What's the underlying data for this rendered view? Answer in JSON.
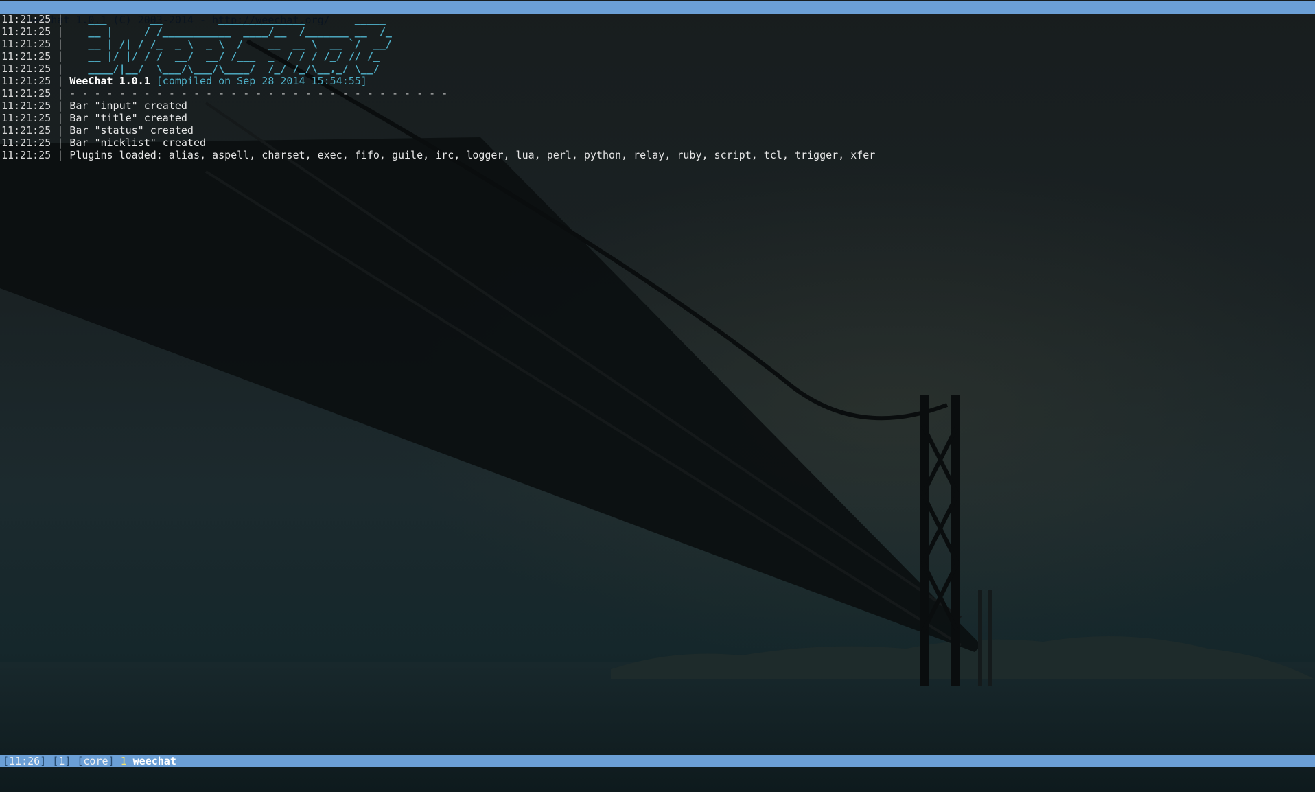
{
  "title_bar": {
    "text": "WeeChat 1.0.1 (C) 2003-2014 - http://weechat.org/"
  },
  "chat": {
    "separator": "|",
    "logo_lines": [
      {
        "time": "11:21:25",
        "text": "   ___       __         ______________        _____ "
      },
      {
        "time": "11:21:25",
        "text": "   __ |     / /___________  ____/__  /_______ __  /_"
      },
      {
        "time": "11:21:25",
        "text": "   __ | /| / /_  _ \\  _ \\  /    __  __ \\  __ `/  __/"
      },
      {
        "time": "11:21:25",
        "text": "   __ |/ |/ / /  __/  __/ /___  _  / / / /_/ // /_  "
      },
      {
        "time": "11:21:25",
        "text": "   ____/|__/  \\___/\\___/\\____/  /_/ /_/\\__,_/ \\__/  "
      }
    ],
    "version_line": {
      "time": "11:21:25",
      "name": "WeeChat 1.0.1",
      "compiled": "[compiled on Sep 28 2014 15:54:55]"
    },
    "dashes_line": {
      "time": "11:21:25",
      "text": "- - - - - - - - - - - - - - - - - - - - - - - - - - - - - - -"
    },
    "messages": [
      {
        "time": "11:21:25",
        "text": "Bar \"input\" created"
      },
      {
        "time": "11:21:25",
        "text": "Bar \"title\" created"
      },
      {
        "time": "11:21:25",
        "text": "Bar \"status\" created"
      },
      {
        "time": "11:21:25",
        "text": "Bar \"nicklist\" created"
      },
      {
        "time": "11:21:25",
        "text": "Plugins loaded: alias, aspell, charset, exec, fifo, guile, irc, logger, lua, perl, python, relay, ruby, script, tcl, trigger, xfer"
      }
    ]
  },
  "status_bar": {
    "time": "11:26",
    "buffer_count": "1",
    "plugin": "core",
    "buffer_number": "1",
    "buffer_name": "weechat",
    "open_bracket": "[",
    "close_bracket": "]"
  },
  "input": {
    "value": ""
  },
  "colors": {
    "bar_background": "#6b9fd6",
    "logo": "#4fb0c8",
    "text": "#d6d6d6",
    "buffer_number": "#f7e36a"
  },
  "background": {
    "icon": "suspension-bridge-wallpaper"
  }
}
